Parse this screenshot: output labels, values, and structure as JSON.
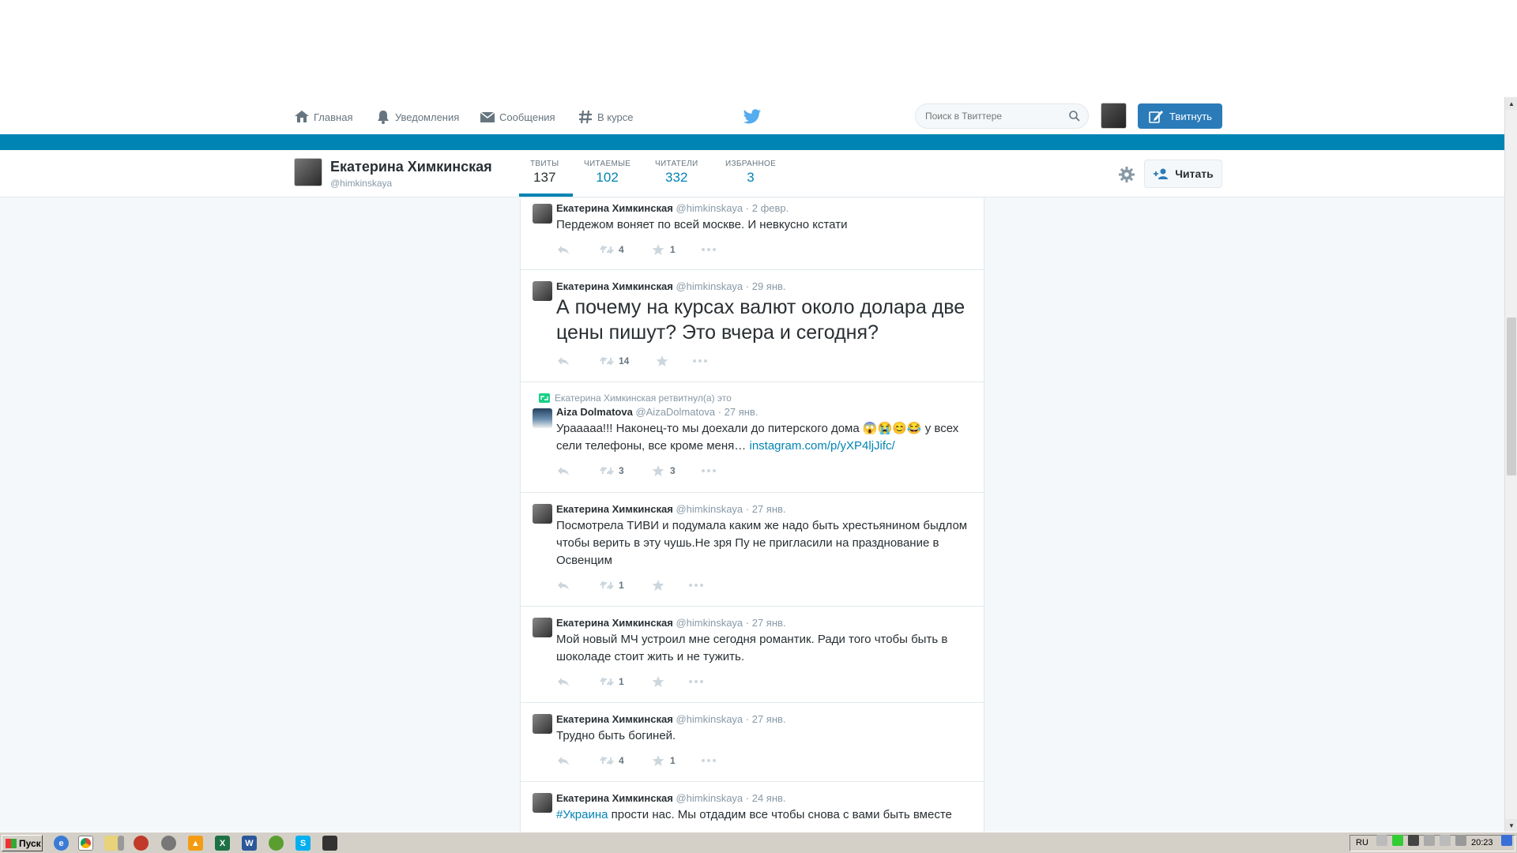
{
  "nav": {
    "home": "Главная",
    "notifications": "Уведомления",
    "messages": "Сообщения",
    "trends": "В курсе",
    "search_placeholder": "Поиск в Твиттере",
    "tweet_button": "Твитнуть"
  },
  "profile": {
    "name": "Екатерина Химкинская",
    "handle": "@himkinskaya",
    "stats": [
      {
        "label": "ТВИТЫ",
        "value": "137"
      },
      {
        "label": "ЧИТАЕМЫЕ",
        "value": "102"
      },
      {
        "label": "ЧИТАТЕЛИ",
        "value": "332"
      },
      {
        "label": "ИЗБРАННОЕ",
        "value": "3"
      }
    ],
    "follow_button": "Читать"
  },
  "tweets": [
    {
      "name": "Екатерина Химкинская",
      "handle": "@himkinskaya",
      "time": "· 2 февр.",
      "text": "Пердежом воняет по всей москве. И невкусно кстати",
      "retweets": "4",
      "favorites": "1"
    },
    {
      "name": "Екатерина Химкинская",
      "handle": "@himkinskaya",
      "time": "· 29 янв.",
      "text": "А почему на курсах валют около долара две цены пишут? Это вчера и сегодня?",
      "retweets": "14",
      "favorites": ""
    },
    {
      "context": "Екатерина Химкинская ретвитнул(а) это",
      "name": "Aiza Dolmatova",
      "handle": "@AizaDolmatova",
      "time": "· 27 янв.",
      "text": "Урааааа!!! Наконец-то мы доехали до питерского дома 😱😭😊😂 у всех сели телефоны, все кроме меня…",
      "link": "instagram.com/p/yXP4ljJifc/",
      "retweets": "3",
      "favorites": "3"
    },
    {
      "name": "Екатерина Химкинская",
      "handle": "@himkinskaya",
      "time": "· 27 янв.",
      "text": "Посмотрела ТИВИ и подумала каким же надо быть хрестьянином быдлом чтобы верить в эту чушь.Не зря Пу не пригласили на празднование в Освенцим",
      "retweets": "1",
      "favorites": ""
    },
    {
      "name": "Екатерина Химкинская",
      "handle": "@himkinskaya",
      "time": "· 27 янв.",
      "text": "Мой новый МЧ устроил мне сегодня романтик. Ради того чтобы быть в шоколаде стоит жить и не тужить.",
      "retweets": "1",
      "favorites": ""
    },
    {
      "name": "Екатерина Химкинская",
      "handle": "@himkinskaya",
      "time": "· 27 янв.",
      "text": "Трудно быть богиней.",
      "retweets": "4",
      "favorites": "1"
    },
    {
      "name": "Екатерина Химкинская",
      "handle": "@himkinskaya",
      "time": "· 24 янв.",
      "hashtag": "#Украина",
      "text": "прости нас. Мы отдадим все чтобы снова с вами быть вместе",
      "retweets": "",
      "favorites": ""
    }
  ],
  "taskbar": {
    "start": "Пуск",
    "lang": "RU",
    "clock": "20:23"
  }
}
